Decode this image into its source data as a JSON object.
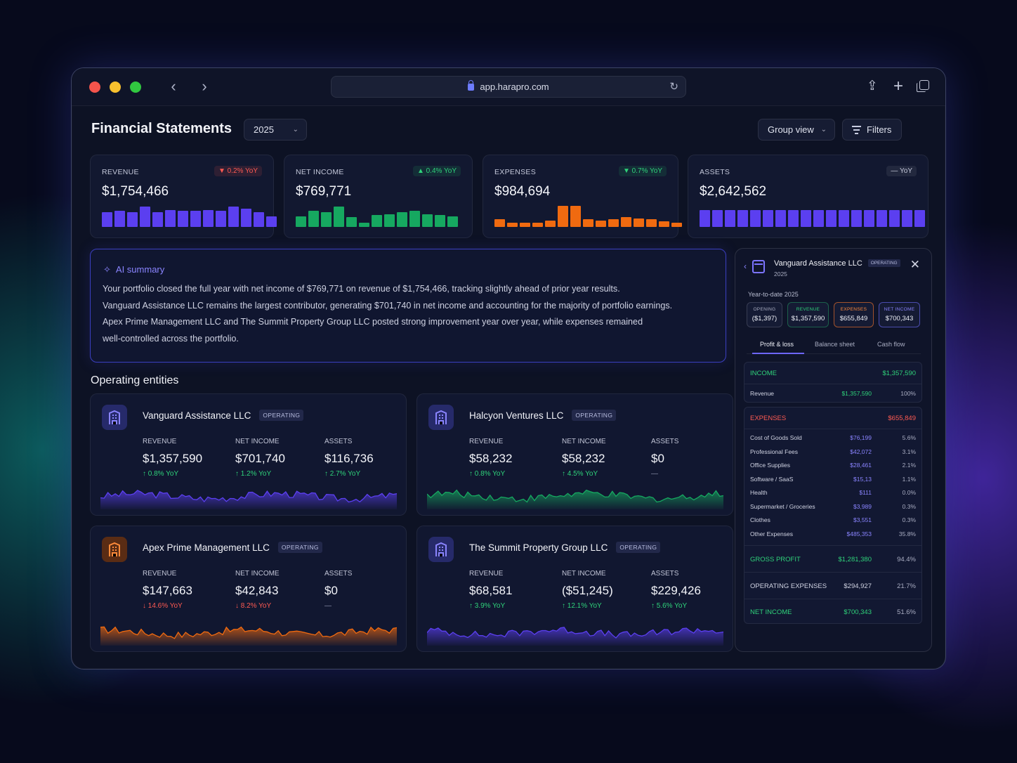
{
  "browser": {
    "url": "app.harapro.com"
  },
  "header": {
    "title": "Financial Statements",
    "year": "2025",
    "group_view": "Group view",
    "filters": "Filters"
  },
  "kpis": [
    {
      "label": "REVENUE",
      "value": "$1,754,466",
      "change": "0.2% YoY",
      "direction": "down",
      "color": "#5b3ff0",
      "bars": [
        0.7,
        0.75,
        0.7,
        0.95,
        0.7,
        0.8,
        0.75,
        0.75,
        0.8,
        0.75,
        0.95,
        0.85,
        0.7,
        0.5
      ]
    },
    {
      "label": "NET INCOME",
      "value": "$769,771",
      "change": "0.4% YoY",
      "direction": "up",
      "color": "#16a860",
      "bars": [
        0.5,
        0.75,
        0.7,
        0.95,
        0.45,
        0.2,
        0.55,
        0.6,
        0.7,
        0.75,
        0.6,
        0.55,
        0.5
      ]
    },
    {
      "label": "EXPENSES",
      "value": "$984,694",
      "change": "0.7% YoY",
      "direction": "down-green",
      "color": "#f06a10",
      "bars": [
        0.35,
        0.2,
        0.2,
        0.2,
        0.3,
        1.0,
        1.0,
        0.35,
        0.3,
        0.35,
        0.45,
        0.4,
        0.35,
        0.25,
        0.2
      ]
    },
    {
      "label": "ASSETS",
      "value": "$2,642,562",
      "change": "— YoY",
      "direction": "flat",
      "color": "#5b3ff0",
      "bars": [
        0.8,
        0.8,
        0.8,
        0.8,
        0.8,
        0.8,
        0.8,
        0.8,
        0.8,
        0.8,
        0.8,
        0.8,
        0.8,
        0.8,
        0.8,
        0.8,
        0.8,
        0.8
      ]
    }
  ],
  "ai_summary": {
    "title": "AI summary",
    "lines": [
      "Your portfolio closed the full year with net income of $769,771 on revenue of $1,754,466, tracking slightly ahead of prior year results.",
      "Vanguard Assistance LLC remains the largest contributor, generating $701,740 in net income and accounting for the majority of portfolio earnings.",
      "Apex Prime Management LLC and The Summit Property Group LLC posted strong improvement year over year, while expenses remained",
      "well-controlled across the portfolio."
    ]
  },
  "entities_title": "Operating entities",
  "entities": [
    {
      "name": "Vanguard Assistance LLC",
      "status": "OPERATING",
      "icon_color": "blue",
      "spark_color": "#5b3ff0",
      "revenue_label": "REVENUE",
      "revenue": "$1,357,590",
      "revenue_change": "↑ 0.8% YoY",
      "revenue_dir": "up",
      "net_label": "NET INCOME",
      "net": "$701,740",
      "net_change": "↑ 1.2% YoY",
      "net_dir": "up",
      "assets_label": "ASSETS",
      "assets": "$116,736",
      "assets_change": "↑ 2.7% YoY",
      "assets_dir": "up"
    },
    {
      "name": "Halcyon Ventures LLC",
      "status": "OPERATING",
      "icon_color": "blue",
      "spark_color": "#16a860",
      "revenue_label": "REVENUE",
      "revenue": "$58,232",
      "revenue_change": "↑ 0.8% YoY",
      "revenue_dir": "up",
      "net_label": "NET INCOME",
      "net": "$58,232",
      "net_change": "↑ 4.5% YoY",
      "net_dir": "up",
      "assets_label": "ASSETS",
      "assets": "$0",
      "assets_change": "—",
      "assets_dir": "flat"
    },
    {
      "name": "Apex Prime Management LLC",
      "status": "OPERATING",
      "icon_color": "orange",
      "spark_color": "#f06a10",
      "revenue_label": "REVENUE",
      "revenue": "$147,663",
      "revenue_change": "↓ 14.6% YoY",
      "revenue_dir": "down",
      "net_label": "NET INCOME",
      "net": "$42,843",
      "net_change": "↓ 8.2% YoY",
      "net_dir": "down",
      "assets_label": "ASSETS",
      "assets": "$0",
      "assets_change": "—",
      "assets_dir": "flat"
    },
    {
      "name": "The Summit Property Group LLC",
      "status": "OPERATING",
      "icon_color": "blue",
      "spark_color": "#5b3ff0",
      "revenue_label": "REVENUE",
      "revenue": "$68,581",
      "revenue_change": "↑ 3.9% YoY",
      "revenue_dir": "up",
      "net_label": "NET INCOME",
      "net": "($51,245)",
      "net_change": "↑ 12.1% YoY",
      "net_dir": "up",
      "assets_label": "ASSETS",
      "assets": "$229,426",
      "assets_change": "↑ 5.6% YoY",
      "assets_dir": "up"
    }
  ],
  "panel": {
    "entity": "Vanguard Assistance LLC",
    "status": "OPERATING",
    "year": "2025",
    "ytd_label": "Year-to-date 2025",
    "chips": [
      {
        "label": "OPENING",
        "value": "($1,397)"
      },
      {
        "label": "REVENUE",
        "value": "$1,357,590"
      },
      {
        "label": "EXPENSES",
        "value": "$655,849"
      },
      {
        "label": "NET INCOME",
        "value": "$700,343"
      }
    ],
    "tabs": [
      "Profit & loss",
      "Balance sheet",
      "Cash flow"
    ],
    "income": {
      "label": "INCOME",
      "total": "$1,357,590",
      "rows": [
        {
          "label": "Revenue",
          "amount": "$1,357,590",
          "pct": "100%"
        }
      ]
    },
    "expenses": {
      "label": "EXPENSES",
      "total": "$655,849",
      "rows": [
        {
          "label": "Cost of Goods Sold",
          "amount": "$76,199",
          "pct": "5.6%"
        },
        {
          "label": "Professional Fees",
          "amount": "$42,072",
          "pct": "3.1%"
        },
        {
          "label": "Office Supplies",
          "amount": "$28,461",
          "pct": "2.1%"
        },
        {
          "label": "Software / SaaS",
          "amount": "$15,13",
          "pct": "1.1%"
        },
        {
          "label": "Health",
          "amount": "$111",
          "pct": "0.0%"
        },
        {
          "label": "Supermarket / Groceries",
          "amount": "$3,989",
          "pct": "0.3%"
        },
        {
          "label": "Clothes",
          "amount": "$3,551",
          "pct": "0.3%"
        },
        {
          "label": "Other Expenses",
          "amount": "$485,353",
          "pct": "35.8%"
        }
      ]
    },
    "gross_profit": {
      "label": "GROSS PROFIT",
      "amount": "$1,281,380",
      "pct": "94.4%"
    },
    "operating_expenses": {
      "label": "OPERATING EXPENSES",
      "amount": "$294,927",
      "pct": "21.7%"
    },
    "net_income": {
      "label": "NET INCOME",
      "amount": "$700,343",
      "pct": "51.6%"
    }
  }
}
